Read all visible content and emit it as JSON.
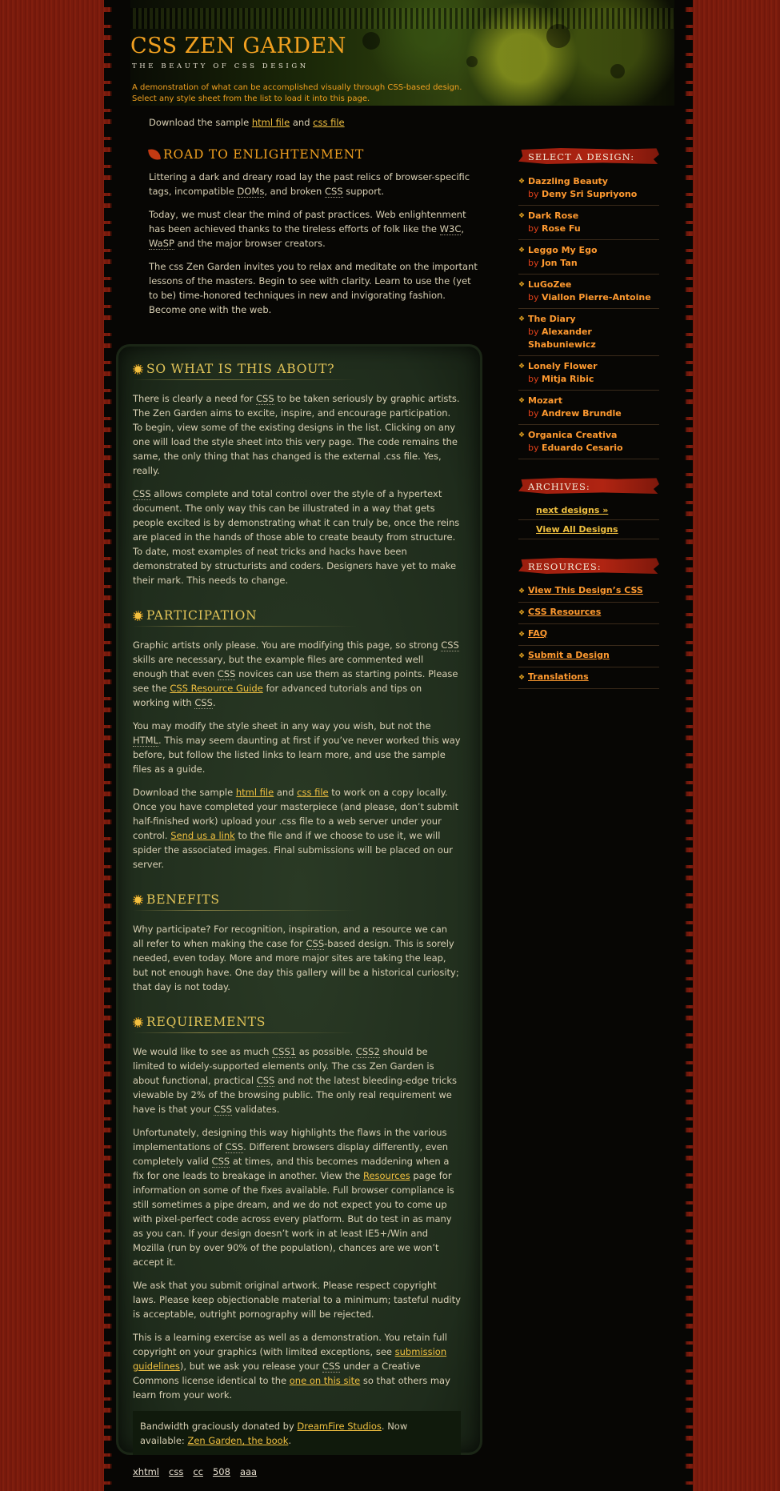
{
  "header": {
    "title": "CSS ZEN GARDEN",
    "tagline": "THE BEAUTY OF CSS DESIGN",
    "summary": "A demonstration of what can be accomplished visually through CSS-based design. Select any style sheet from the list to load it into this page."
  },
  "intro": {
    "download_prefix": "Download the sample",
    "html_file": "html file",
    "and": "and",
    "css_file": "css file",
    "title": "ROAD TO ENLIGHTENMENT",
    "p1_a": "Littering a dark and dreary road lay the past relics of browser-specific tags, incompatible",
    "p1_doms": "DOMs",
    "p1_b": ", and broken",
    "p1_css": "CSS",
    "p1_c": "support.",
    "p2_a": "Today, we must clear the mind of past practices. Web enlightenment has been achieved thanks to the tireless efforts of folk like the",
    "p2_w3c": "W3C",
    "p2_wasp": "WaSP",
    "p2_b": "and the major browser creators.",
    "p3": "The css Zen Garden invites you to relax and meditate on the important lessons of the masters. Begin to see with clarity. Learn to use the (yet to be) time-honored techniques in new and invigorating fashion. Become one with the web."
  },
  "about": {
    "title": "SO WHAT IS THIS ABOUT?",
    "p1_a": "There is clearly a need for",
    "p1_css": "CSS",
    "p1_b": "to be taken seriously by graphic artists. The Zen Garden aims to excite, inspire, and encourage participation. To begin, view some of the existing designs in the list. Clicking on any one will load the style sheet into this very page. The code remains the same, the only thing that has changed is the external .css file. Yes, really.",
    "p2_css": "CSS",
    "p2_b": "allows complete and total control over the style of a hypertext document. The only way this can be illustrated in a way that gets people excited is by demonstrating what it can truly be, once the reins are placed in the hands of those able to create beauty from structure. To date, most examples of neat tricks and hacks have been demonstrated by structurists and coders. Designers have yet to make their mark. This needs to change."
  },
  "participation": {
    "title": "PARTICIPATION",
    "p1_a": "Graphic artists only please. You are modifying this page, so strong",
    "p1_css1": "CSS",
    "p1_b": "skills are necessary, but the example files are commented well enough that even",
    "p1_css2": "CSS",
    "p1_c": "novices can use them as starting points. Please see the",
    "p1_link": "CSS Resource Guide",
    "p1_d": "for advanced tutorials and tips on working with",
    "p1_css3": "CSS",
    "p1_e": ".",
    "p2_a": "You may modify the style sheet in any way you wish, but not the",
    "p2_html": "HTML",
    "p2_b": ". This may seem daunting at first if you’ve never worked this way before, but follow the listed links to learn more, and use the sample files as a guide.",
    "p3_a": "Download the sample",
    "p3_html": "html file",
    "p3_and": "and",
    "p3_css": "css file",
    "p3_b": "to work on a copy locally. Once you have completed your masterpiece (and please, don’t submit half-finished work) upload your .css file to a web server under your control.",
    "p3_link": "Send us a link",
    "p3_c": "to the file and if we choose to use it, we will spider the associated images. Final submissions will be placed on our server."
  },
  "benefits": {
    "title": "BENEFITS",
    "p1_a": "Why participate? For recognition, inspiration, and a resource we can all refer to when making the case for",
    "p1_css": "CSS",
    "p1_b": "-based design. This is sorely needed, even today. More and more major sites are taking the leap, but not enough have. One day this gallery will be a historical curiosity; that day is not today."
  },
  "requirements": {
    "title": "REQUIREMENTS",
    "p1_a": "We would like to see as much",
    "p1_css1": "CSS1",
    "p1_b": "as possible.",
    "p1_css2": "CSS2",
    "p1_c": "should be limited to widely-supported elements only. The css Zen Garden is about functional, practical",
    "p1_css3": "CSS",
    "p1_d": "and not the latest bleeding-edge tricks viewable by 2% of the browsing public. The only real requirement we have is that your",
    "p1_css4": "CSS",
    "p1_e": "validates.",
    "p2_a": "Unfortunately, designing this way highlights the flaws in the various implementations of",
    "p2_css1": "CSS",
    "p2_b": ". Different browsers display differently, even completely valid",
    "p2_css2": "CSS",
    "p2_c": "at times, and this becomes maddening when a fix for one leads to breakage in another. View the",
    "p2_link": "Resources",
    "p2_d": "page for information on some of the fixes available. Full browser compliance is still sometimes a pipe dream, and we do not expect you to come up with pixel-perfect code across every platform. But do test in as many as you can. If your design doesn’t work in at least IE5+/Win and Mozilla (run by over 90% of the population), chances are we won’t accept it.",
    "p3": "We ask that you submit original artwork. Please respect copyright laws. Please keep objectionable material to a minimum; tasteful nudity is acceptable, outright pornography will be rejected.",
    "p4_a": "This is a learning exercise as well as a demonstration. You retain full copyright on your graphics (with limited exceptions, see",
    "p4_link1": "submission guidelines",
    "p4_b": "), but we ask you release your",
    "p4_css": "CSS",
    "p4_c": "under a Creative Commons license identical to the",
    "p4_link2": "one on this site",
    "p4_d": "so that others may learn from your work."
  },
  "bandwidth": {
    "a": "Bandwidth graciously donated by",
    "link1": "DreamFire Studios",
    "b": ". Now available:",
    "link2": "Zen Garden, the book",
    "c": "."
  },
  "footer": [
    "xhtml",
    "css",
    "cc",
    "508",
    "aaa"
  ],
  "sidebar": {
    "select_title": "SELECT A DESIGN:",
    "by": "by",
    "designs": [
      {
        "name": "Dazzling Beauty",
        "author": "Deny Sri Supriyono"
      },
      {
        "name": "Dark Rose",
        "author": "Rose Fu"
      },
      {
        "name": "Leggo My Ego",
        "author": "Jon Tan"
      },
      {
        "name": "LuGoZee",
        "author": "Viallon Pierre-Antoine"
      },
      {
        "name": "The Diary",
        "author": "Alexander Shabuniewicz"
      },
      {
        "name": "Lonely Flower",
        "author": "Mitja Ribic"
      },
      {
        "name": "Mozart",
        "author": "Andrew Brundle"
      },
      {
        "name": "Organica Creativa",
        "author": "Eduardo Cesario"
      }
    ],
    "archives_title": "ARCHIVES:",
    "archives": [
      "next designs »",
      "View All Designs"
    ],
    "resources_title": "RESOURCES:",
    "resources": [
      "View This Design’s CSS",
      "CSS Resources",
      "FAQ",
      "Submit a Design",
      "Translations"
    ]
  }
}
